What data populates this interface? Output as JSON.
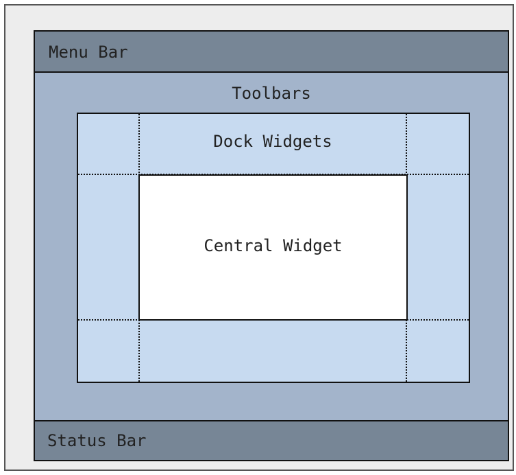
{
  "menu_bar": {
    "label": "Menu Bar"
  },
  "toolbars": {
    "label": "Toolbars"
  },
  "dock_widgets": {
    "label": "Dock Widgets"
  },
  "central_widget": {
    "label": "Central Widget"
  },
  "status_bar": {
    "label": "Status Bar"
  },
  "colors": {
    "frame_background": "#ededed",
    "bar_fill": "#778696",
    "toolbar_area": "#a3b4cb",
    "dock_area": "#c7daf0",
    "central_widget": "#ffffff",
    "outline": "#111111"
  }
}
